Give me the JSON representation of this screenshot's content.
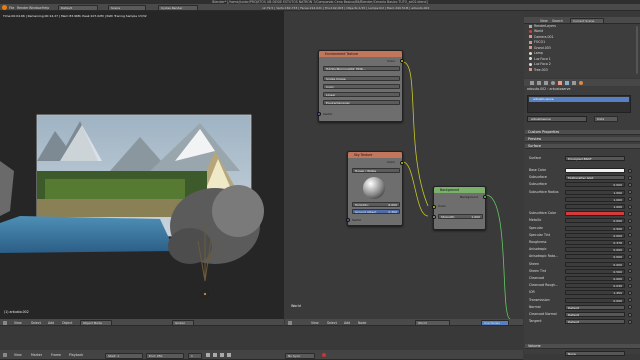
{
  "window": {
    "title": "Blender* [/home/Junior/PROJETOS UB DESIE ESTUTOS NATRON 7/Compondo Cena Basica/88/Blender/Cenario Basico TUTO_sd02.blend]"
  },
  "info_header": {
    "menus": [
      "File",
      "Render",
      "Window",
      "Help"
    ],
    "layout": "Default",
    "scene": "Scene",
    "engine": "Cycles Render",
    "stats": "v2.79.5 | Verts:182,733 | Faces:212,021 | Tris:102,003 | Objects:1/15 | Lamps:0/2 | Mem:240.51M | arbusto.002"
  },
  "viewport": {
    "render_status": "Time:00:04.66 | Remaining:00:14.27 | Mem:83.96M, Peak:107.02M | Path Tracing Sample 13/32",
    "object_label": "(1) arbusto.002",
    "header": {
      "menus": [
        "View",
        "Select",
        "Add",
        "Object"
      ],
      "mode": "Object Mode",
      "pivot": "Global"
    }
  },
  "node_editor": {
    "label": "World",
    "header": {
      "menus": [
        "View",
        "Select",
        "Add",
        "Node"
      ],
      "world": "World",
      "use_nodes": "Use Nodes"
    },
    "nodes": {
      "env_texture": {
        "title": "Environment Texture",
        "out_label": "Color",
        "image": "HdrSkyMorning002_HDR...",
        "fields": [
          "Single Image",
          "Color",
          "Linear",
          "Equirectangular"
        ],
        "in_label": "Vector"
      },
      "sky_texture": {
        "title": "Sky Texture",
        "out_label": "Color",
        "model": "Hosek / Wilkie",
        "turbidity_label": "Turbidity:",
        "turbidity": "6.000",
        "albedo_label": "Ground Albed:",
        "albedo": "0.300",
        "in_label": "Vector"
      },
      "background": {
        "title": "Background",
        "out_label": "Background",
        "color_label": "Color",
        "strength_label": "Strength:",
        "strength": "1.000"
      }
    }
  },
  "outliner": {
    "header": {
      "view": "View",
      "search": "Search",
      "scene": "Current Scene"
    },
    "items": [
      "RenderLayers",
      "World",
      "Camera.001",
      "FOCO1",
      "Grond.003",
      "Lamp",
      "Luz Foco 1",
      "Luz Foco 2",
      "Tree.003"
    ]
  },
  "properties": {
    "object_name": "arbusto.002",
    "material_name": "arbustoserve",
    "material_slot": "arbusto.serve",
    "data_label": "Data",
    "panels": [
      "Custom Properties",
      "Preview",
      "Surface"
    ],
    "surface_label": "Surface",
    "surface_shader": "Principled BSDF",
    "rows": [
      {
        "label": "Base Color",
        "value": "",
        "kind": "color-white"
      },
      {
        "label": "Subsurface",
        "value": "Multiscatter GGX",
        "kind": "dropdown"
      },
      {
        "label": "Subsurface",
        "value": "0.000",
        "kind": "num"
      },
      {
        "label": "Subsurface Radius",
        "value": "1.000",
        "kind": "num"
      },
      {
        "label": "",
        "value": "1.000",
        "kind": "num"
      },
      {
        "label": "",
        "value": "1.000",
        "kind": "num"
      },
      {
        "label": "Subsurface Color",
        "value": "",
        "kind": "color-red"
      },
      {
        "label": "Metallic",
        "value": "0.000",
        "kind": "num"
      },
      {
        "label": "Specular",
        "value": "0.500",
        "kind": "num"
      },
      {
        "label": "Specular Tint",
        "value": "0.000",
        "kind": "num"
      },
      {
        "label": "Roughness",
        "value": "0.376",
        "kind": "num"
      },
      {
        "label": "Anisotropic",
        "value": "0.000",
        "kind": "num"
      },
      {
        "label": "Anisotropic Rota...",
        "value": "0.000",
        "kind": "num"
      },
      {
        "label": "Sheen",
        "value": "0.000",
        "kind": "num"
      },
      {
        "label": "Sheen Tint",
        "value": "0.500",
        "kind": "num"
      },
      {
        "label": "Clearcoat",
        "value": "0.000",
        "kind": "num"
      },
      {
        "label": "Clearcoat Rough...",
        "value": "0.030",
        "kind": "num"
      },
      {
        "label": "IOR",
        "value": "1.450",
        "kind": "num"
      },
      {
        "label": "Transmission",
        "value": "0.000",
        "kind": "num"
      },
      {
        "label": "Normal",
        "value": "Default",
        "kind": "dropdown"
      },
      {
        "label": "Clearcoat Normal",
        "value": "Default",
        "kind": "dropdown"
      },
      {
        "label": "Tangent",
        "value": "Default",
        "kind": "dropdown"
      }
    ],
    "volume_label": "Volume",
    "volume_value": "None"
  },
  "timeline": {
    "menus": [
      "View",
      "Marker",
      "Frame",
      "Playback"
    ],
    "start_label": "Start:",
    "start": "1",
    "end_label": "End:",
    "end": "250",
    "current": "1",
    "sync": "No Sync"
  },
  "colors": {
    "env_head": "#c2765c",
    "sky_head": "#c2765c",
    "bg_head": "#7ab06a",
    "socket_color": "#c7c729",
    "socket_vector": "#6363c7",
    "socket_shader": "#63c763",
    "selected_material": "#5680c2",
    "subsurface_red": "#d63a3a"
  }
}
